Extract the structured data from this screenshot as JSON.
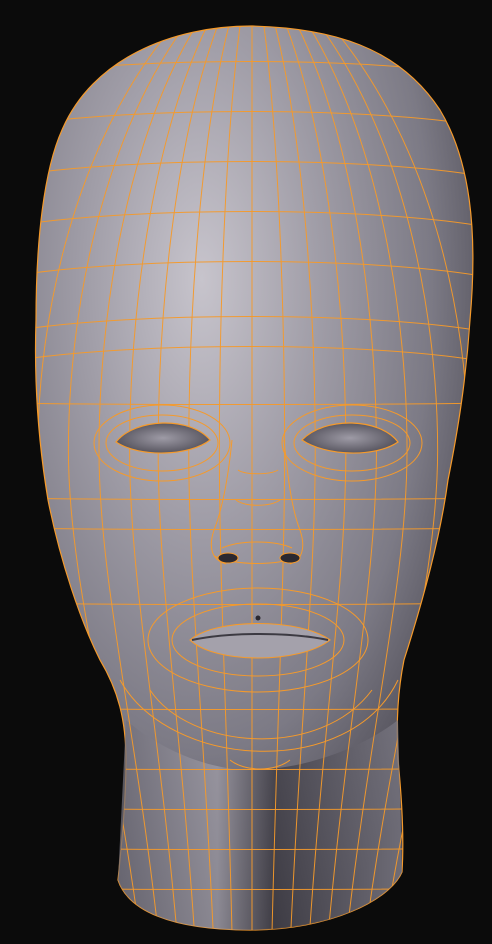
{
  "viewport": {
    "background": "#0b0b0b",
    "mesh": {
      "surface_color": "#8e8c96",
      "highlight_color": "#c9c6cf",
      "shadow_color": "#3f3d47",
      "wire_color": "#f59a2b",
      "selection_state": "selected",
      "object_type": "head-mesh"
    }
  }
}
